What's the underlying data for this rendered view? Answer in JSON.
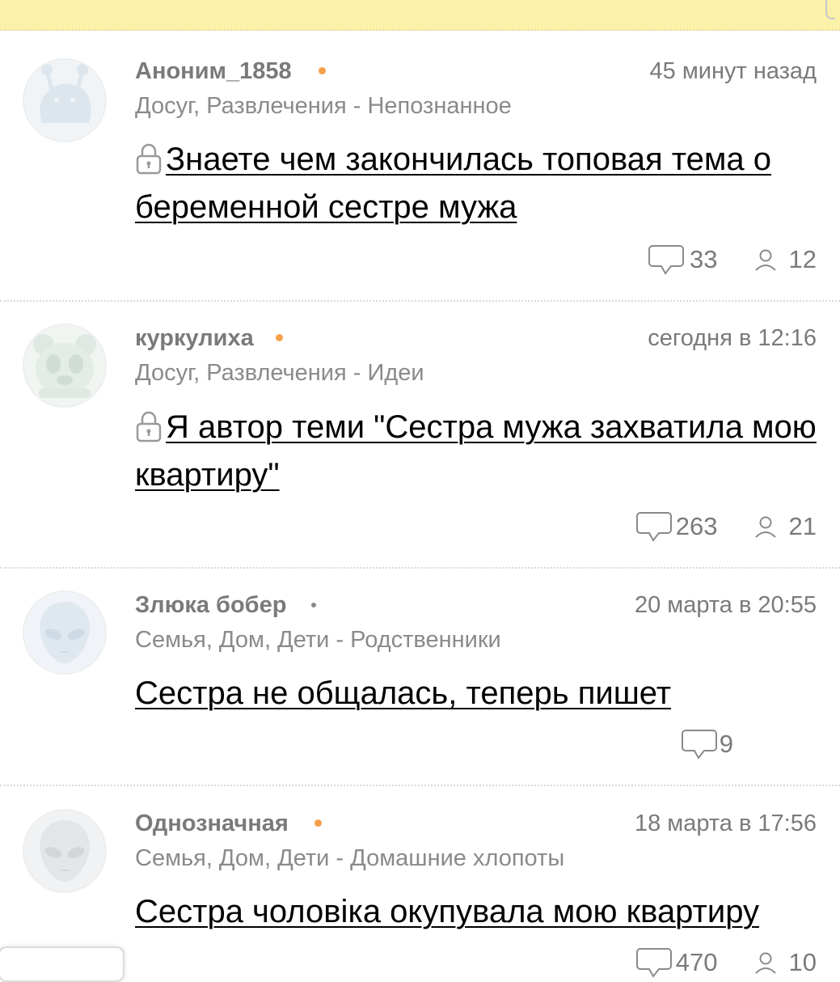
{
  "colors": {
    "topbar": "#fbf1a8",
    "meta_text": "#7a7a7a",
    "title_text": "#000000",
    "online_dot": "#f5a04b",
    "offline_dot": "#8a8a8a"
  },
  "posts": [
    {
      "author": "Аноним_1858",
      "status": "online",
      "date": "45 минут назад",
      "category": "Досуг, Развлечения - Непознанное",
      "locked": true,
      "title": "Знаете чем закончилась топовая тема о беременной сестре мужа",
      "comments": "33",
      "participants": "12",
      "avatar_icon": "snail-avatar-icon"
    },
    {
      "author": "куркулиха",
      "status": "online",
      "date": "сегодня в 12:16",
      "category": "Досуг, Развлечения - Идеи",
      "locked": true,
      "title": "Я автор теми \"Сестра мужа захватила мою квартиру\"",
      "comments": "263",
      "participants": "21",
      "avatar_icon": "panda-avatar-icon"
    },
    {
      "author": "Злюка бобер",
      "status": "offline",
      "date": "20 марта в 20:55",
      "category": "Семья, Дом, Дети - Родственники",
      "locked": false,
      "title": "Сестра не общалась, теперь пишет",
      "comments": "9",
      "participants": "",
      "avatar_icon": "alien-avatar-icon"
    },
    {
      "author": "Однозначная",
      "status": "online",
      "date": "18 марта в 17:56",
      "category": "Семья, Дом, Дети - Домашние хлопоты",
      "locked": false,
      "title": "Сестра чоловіка окупувала мою квартиру",
      "comments": "470",
      "participants": "10",
      "avatar_icon": "alien-avatar-icon"
    }
  ]
}
